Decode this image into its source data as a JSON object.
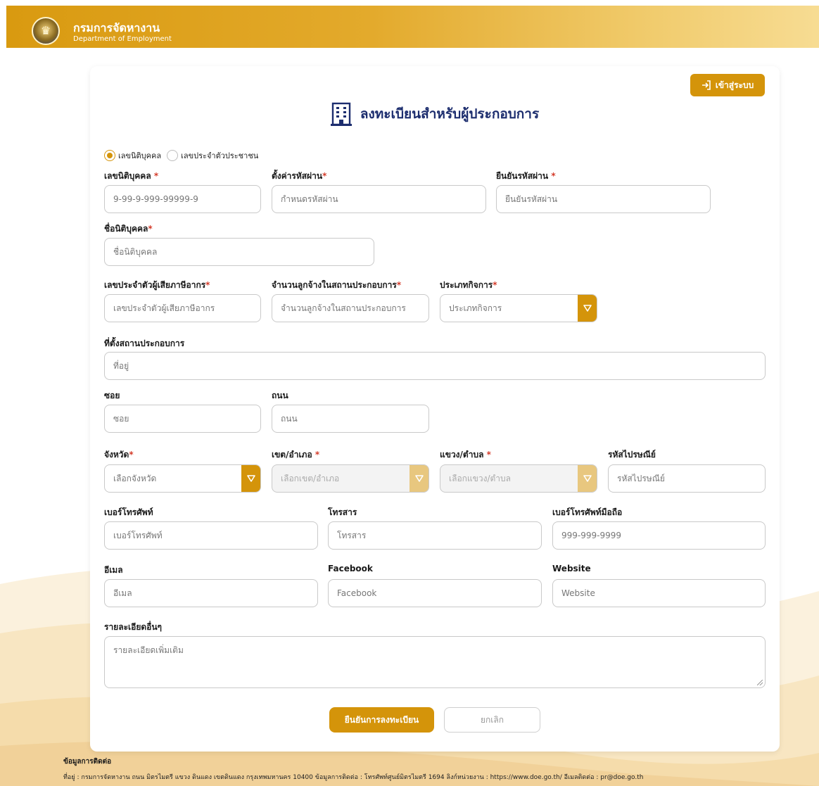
{
  "header": {
    "org_th": "กรมการจัดหางาน",
    "org_en": "Department of Employment"
  },
  "login_button": "เข้าสู่ระบบ",
  "page_title": "ลงทะเบียนสำหรับผู้ประกอบการ",
  "id_type": {
    "options": [
      "เลขนิติบุคคล",
      "เลขประจำตัวประชาชน"
    ],
    "selected": "เลขนิติบุคคล"
  },
  "fields": {
    "juristic_id": {
      "label": "เลขนิติบุคคล",
      "placeholder": "9-99-9-999-99999-9"
    },
    "password": {
      "label": "ตั้งค่ารหัสผ่าน",
      "placeholder": "กำหนดรหัสผ่าน"
    },
    "confirm_password": {
      "label": "ยืนยันรหัสผ่าน",
      "placeholder": "ยืนยันรหัสผ่าน"
    },
    "juristic_name": {
      "label": "ชื่อนิติบุคคล",
      "placeholder": "ชื่อนิติบุคคล"
    },
    "tax_id": {
      "label": "เลขประจำตัวผู้เสียภาษีอากร",
      "placeholder": "เลขประจำตัวผู้เสียภาษีอากร"
    },
    "employee_count": {
      "label": "จำนวนลูกจ้างในสถานประกอบการ",
      "placeholder": "จำนวนลูกจ้างในสถานประกอบการ"
    },
    "business_type": {
      "label": "ประเภทกิจการ",
      "value": "ประเภทกิจการ"
    },
    "address_section": {
      "label": "ที่ตั้งสถานประกอบการ",
      "placeholder": "ที่อยู่"
    },
    "soi": {
      "label": "ซอย",
      "placeholder": "ซอย"
    },
    "road": {
      "label": "ถนน",
      "placeholder": "ถนน"
    },
    "province": {
      "label": "จังหวัด",
      "value": "เลือกจังหวัด"
    },
    "district": {
      "label": "เขต/อำเภอ",
      "value": "เลือกเขต/อำเภอ"
    },
    "subdistrict": {
      "label": "แขวง/ตำบล",
      "value": "เลือกแขวง/ตำบล"
    },
    "postcode": {
      "label": "รหัสไปรษณีย์",
      "placeholder": "รหัสไปรษณีย์"
    },
    "phone": {
      "label": "เบอร์โทรศัพท์",
      "placeholder": "เบอร์โทรศัพท์"
    },
    "fax": {
      "label": "โทรสาร",
      "placeholder": "โทรสาร"
    },
    "mobile": {
      "label": "เบอร์โทรศัพท์มือถือ",
      "placeholder": "999-999-9999"
    },
    "email": {
      "label": "อีเมล",
      "placeholder": "อีเมล"
    },
    "facebook": {
      "label": "Facebook",
      "placeholder": "Facebook"
    },
    "website": {
      "label": "Website",
      "placeholder": "Website"
    },
    "details": {
      "label": "รายละเอียดอื่นๆ",
      "placeholder": "รายละเอียดเพิ่มเติม"
    }
  },
  "required_mark": "*",
  "buttons": {
    "submit": "ยืนยันการลงทะเบียน",
    "cancel": "ยกเลิก"
  },
  "footer": {
    "title": "ข้อมูลการติดต่อ",
    "text": "ที่อยู่ : กรมการจัดหางาน ถนน มิตรไมตรี แขวง ดินแดง เขตดินแดง กรุงเทพมหานคร 10400 ข้อมูลการติดต่อ : โทรศัพท์ศูนย์มิตรไมตรี 1694 ลิงก์หน่วยงาน : https://www.doe.go.th/ อีเมลติดต่อ : pr@doe.go.th"
  },
  "colors": {
    "accent": "#d4940a",
    "title": "#1c2d6e",
    "required": "#d43b2a"
  }
}
